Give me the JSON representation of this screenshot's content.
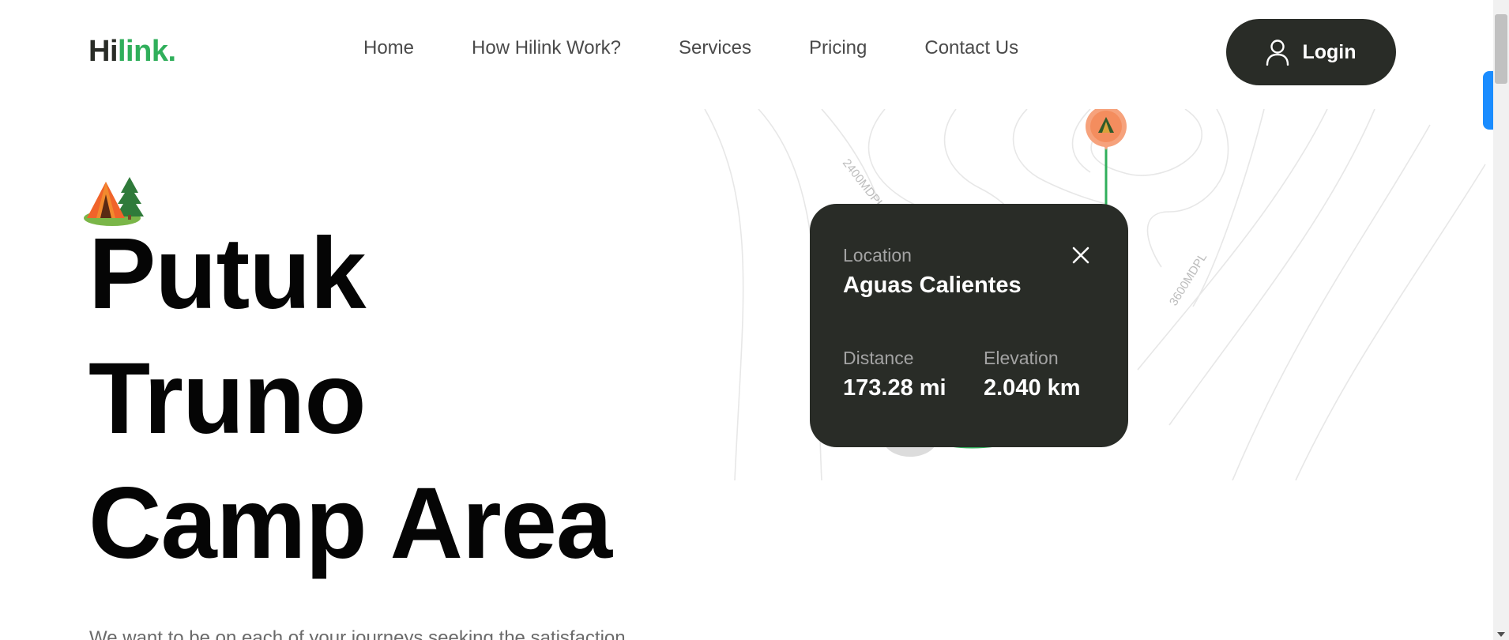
{
  "header": {
    "logo": {
      "part1": "Hi",
      "part2": "link."
    },
    "nav": [
      "Home",
      "How Hilink Work?",
      "Services",
      "Pricing",
      "Contact Us"
    ],
    "login_label": "Login"
  },
  "hero": {
    "title_lines": [
      "Putuk",
      "Truno",
      "Camp Area"
    ],
    "description": "We want to be on each of your journeys seeking the satisfaction"
  },
  "map": {
    "contour_labels": [
      "2400MDPL",
      "3600MDPL"
    ],
    "route_color": "#30af5b",
    "marker_color": "#f6a27c"
  },
  "info_card": {
    "location_label": "Location",
    "location_value": "Aguas Calientes",
    "distance_label": "Distance",
    "distance_value": "173.28 mi",
    "elevation_label": "Elevation",
    "elevation_value": "2.040 km"
  },
  "colors": {
    "dark": "#292c27",
    "green": "#30af5b",
    "accent_blue": "#1a8cff"
  }
}
